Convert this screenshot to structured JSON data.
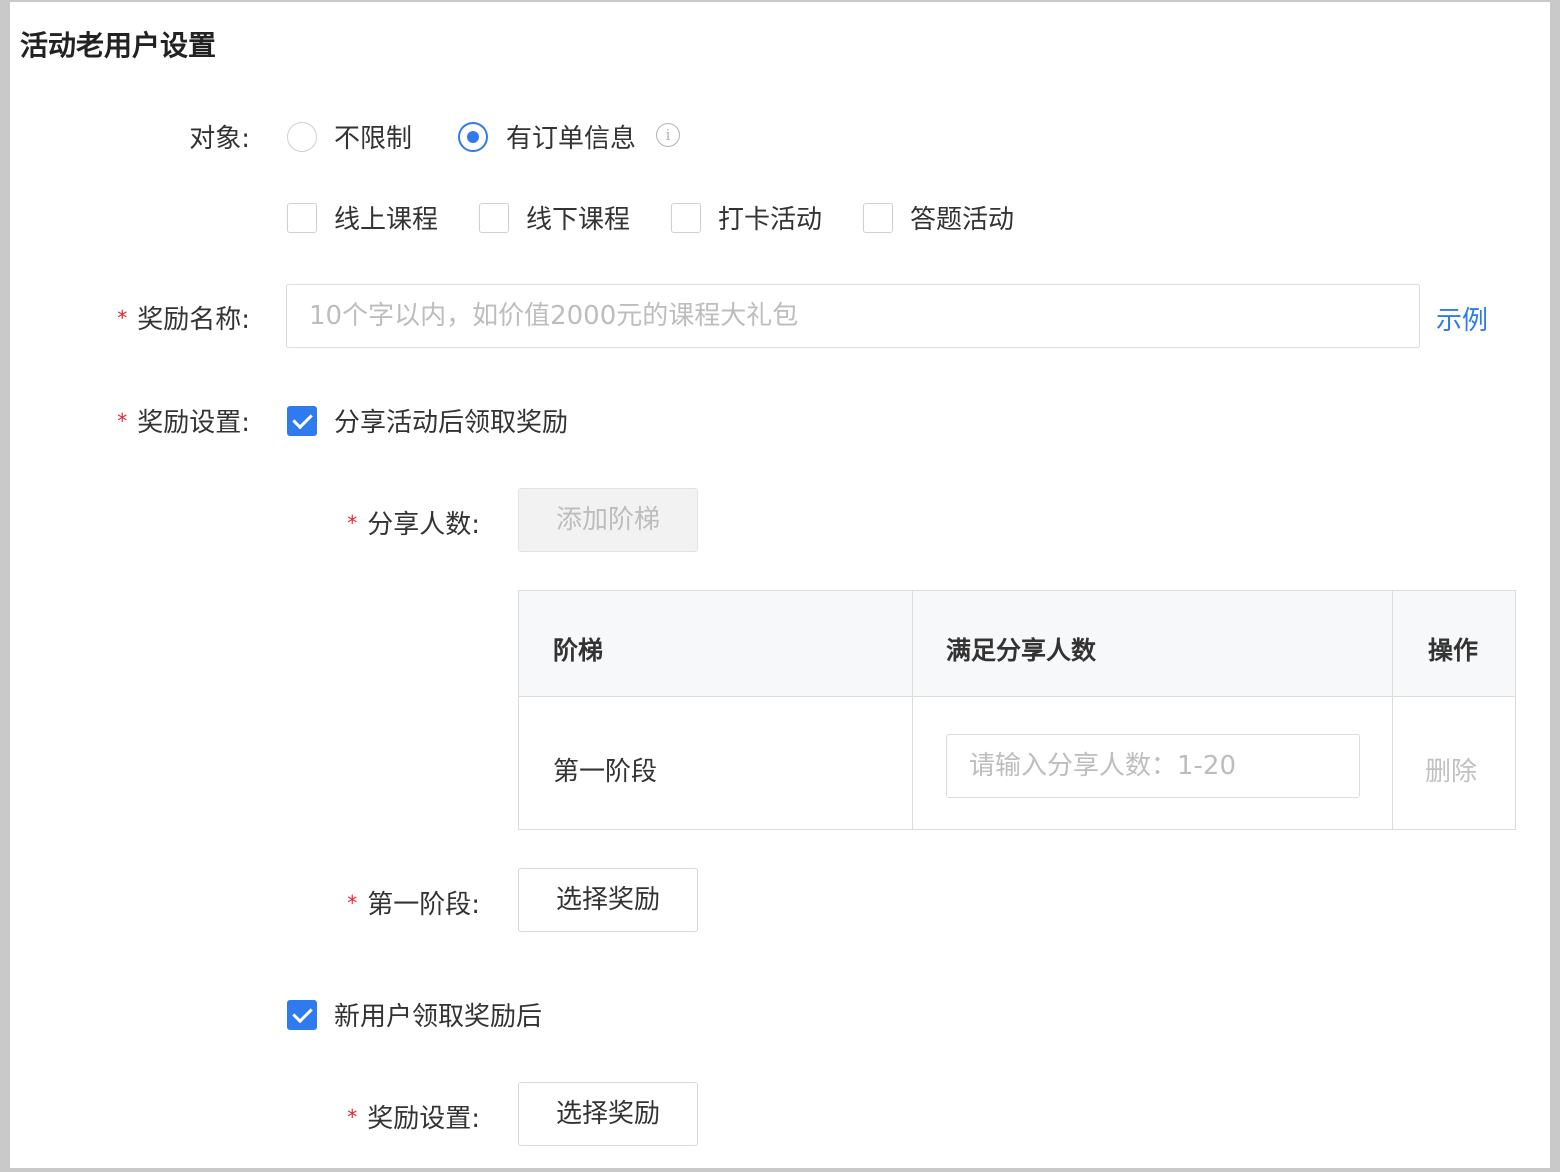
{
  "page_title": "活动老用户设置",
  "target": {
    "label": "对象:",
    "radios": [
      {
        "label": "不限制",
        "selected": false
      },
      {
        "label": "有订单信息",
        "selected": true
      }
    ],
    "info_icon": "info-icon",
    "checkboxes": [
      {
        "label": "线上课程",
        "checked": false
      },
      {
        "label": "线下课程",
        "checked": false
      },
      {
        "label": "打卡活动",
        "checked": false
      },
      {
        "label": "答题活动",
        "checked": false
      }
    ]
  },
  "reward_name": {
    "required_mark": "*",
    "label": "奖励名称:",
    "placeholder": "10个字以内，如价值2000元的课程大礼包",
    "value": "",
    "example_link": "示例"
  },
  "reward_settings": {
    "required_mark": "*",
    "label": "奖励设置:",
    "share_option": {
      "label": "分享活动后领取奖励",
      "checked": true
    },
    "share_count": {
      "required_mark": "*",
      "label": "分享人数:",
      "add_tier_button": "添加阶梯"
    },
    "tier_table": {
      "columns": [
        "阶梯",
        "满足分享人数",
        "操作"
      ],
      "rows": [
        {
          "tier": "第一阶段",
          "input_placeholder": "请输入分享人数：1-20",
          "input_value": "",
          "action": "删除"
        }
      ]
    },
    "stage_one": {
      "required_mark": "*",
      "label": "第一阶段:",
      "select_button": "选择奖励"
    },
    "new_user_option": {
      "label": "新用户领取奖励后",
      "checked": true
    },
    "new_user_reward": {
      "required_mark": "*",
      "label": "奖励设置:",
      "select_button": "选择奖励"
    }
  },
  "colors": {
    "accent": "#2f7bed",
    "required": "#e5242b",
    "placeholder": "#bdbdbd"
  }
}
